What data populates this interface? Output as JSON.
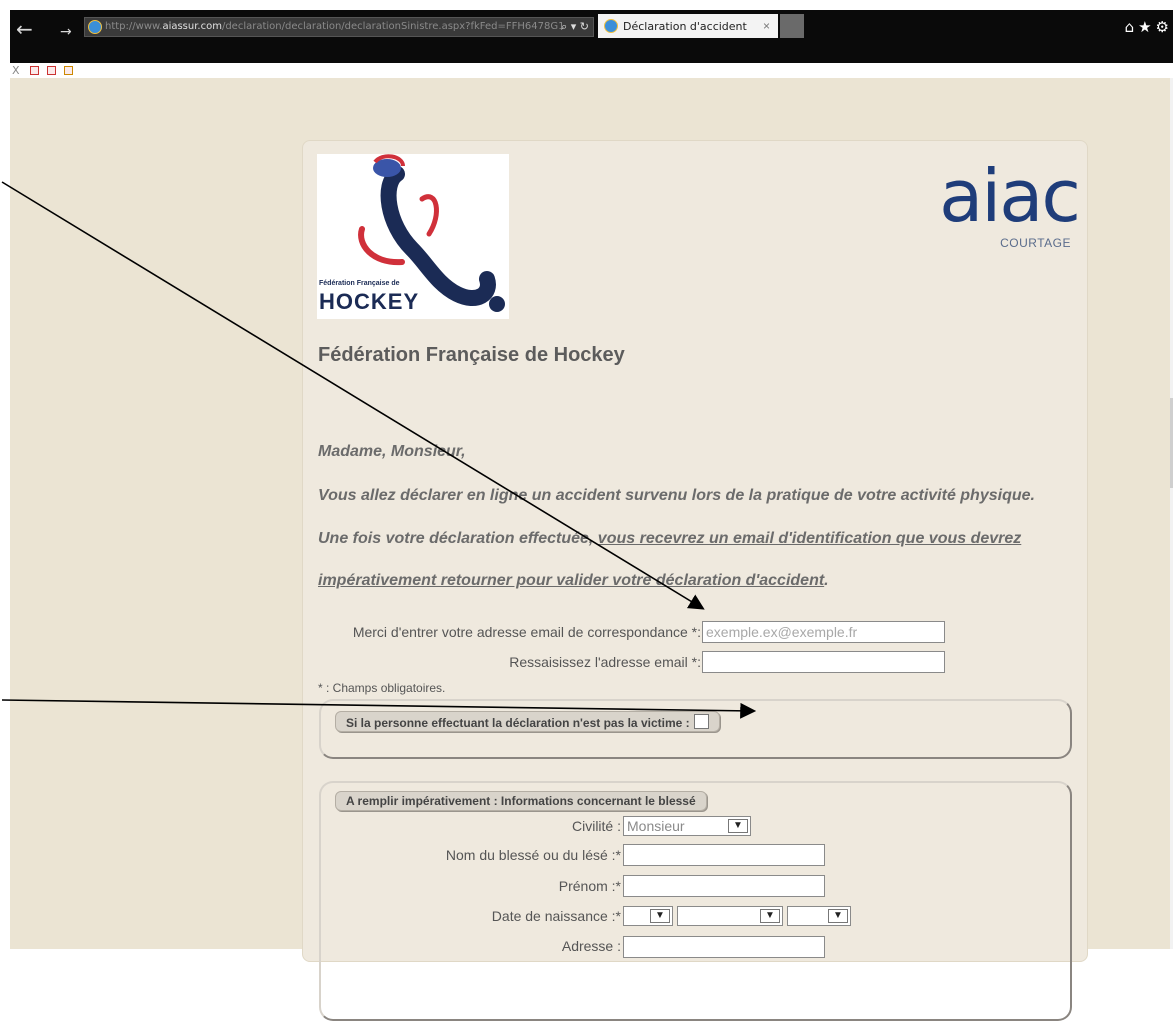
{
  "browser": {
    "url_prefix": "http://www.",
    "url_domain": "aiassur.com",
    "url_path": "/declaration/declaration/declarationSinistre.aspx?fkFed=FFH6478G1",
    "tab_title": "Déclaration d'accident",
    "tab_close": "×",
    "nav_back": "←",
    "nav_forward": "→",
    "addr_tools": "⌕ ▾ ↻",
    "right_icons": "⌂★⚙",
    "cmd_close": "X"
  },
  "header": {
    "federation_logo_text_line1": "Fédération Française de",
    "federation_logo_text_line2": "HOCKEY",
    "aiac_word": "aiac",
    "aiac_sub": "COURTAGE",
    "title": "Fédération Française de Hockey"
  },
  "intro": {
    "greeting": "Madame, Monsieur,",
    "line1": "Vous allez déclarer en ligne un accident survenu lors de la pratique de votre activité physique.",
    "line2_start": "Une fois votre déclaration effectuée, ",
    "line2_underlined": "vous recevrez un email d'identification que vous devrez",
    "line3_underlined": "impérativement retourner pour valider votre déclaration d'accident",
    "line3_end": "."
  },
  "email_form": {
    "email_label": "Merci d'entrer votre adresse email de correspondance *:",
    "email_placeholder": "exemple.ex@exemple.fr",
    "confirm_label": "Ressaisissez l'adresse email *:",
    "required_note": "* : Champs obligatoires."
  },
  "declarant_section": {
    "legend": "Si la personne effectuant la déclaration n'est pas la victime :"
  },
  "victim_section": {
    "legend": "A remplir impérativement : Informations concernant le blessé",
    "civility_label": "Civilité :",
    "civility_value": "Monsieur",
    "name_label": "Nom du blessé ou du lésé :*",
    "firstname_label": "Prénom :*",
    "birthdate_label": "Date de naissance :*",
    "address_label": "Adresse :"
  }
}
